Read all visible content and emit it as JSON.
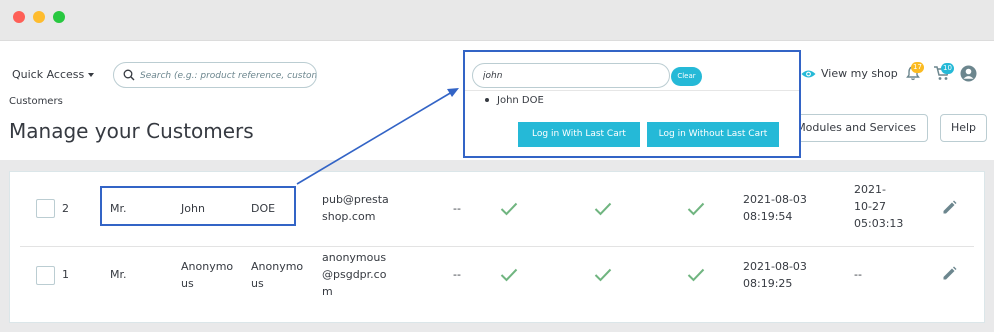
{
  "header": {
    "quick_access": "Quick Access",
    "search_placeholder": "Search (e.g.: product reference, customer",
    "view_shop": "View my shop",
    "notifications_count": "17",
    "orders_count": "10",
    "breadcrumb": "Customers",
    "page_title": "Manage your Customers",
    "modules_button": "Modules and Services",
    "help_button": "Help"
  },
  "popup": {
    "search_value": "john",
    "clear_label": "Clear",
    "result": "John DOE",
    "login_with_cart": "Log in With Last Cart",
    "login_without_cart": "Log in Without Last Cart"
  },
  "rows": [
    {
      "id": "2",
      "title": "Mr.",
      "first": [
        "John"
      ],
      "last": [
        "DOE"
      ],
      "email": [
        "pub@presta",
        "shop.com"
      ],
      "company": "--",
      "registration": [
        "2021-08-03",
        "08:19:54"
      ],
      "last_visit": [
        "2021-",
        "10-27",
        "05:03:13"
      ]
    },
    {
      "id": "1",
      "title": "Mr.",
      "first": [
        "Anonymo",
        "us"
      ],
      "last": [
        "Anonymo",
        "us"
      ],
      "email": [
        "anonymous",
        "@psgdpr.co",
        "m"
      ],
      "company": "--",
      "registration": [
        "2021-08-03",
        "08:19:25"
      ],
      "last_visit": [
        "--"
      ]
    }
  ],
  "colors": {
    "accent": "#25b9d7",
    "highlight": "#3364c6",
    "check": "#70b580",
    "badge_orange": "#fbbb22"
  },
  "icons": {
    "search": "search-icon",
    "eye": "eye-icon",
    "bell": "bell-icon",
    "cart": "cart-icon",
    "user": "user-icon",
    "check": "check-icon",
    "edit": "pencil-icon"
  }
}
